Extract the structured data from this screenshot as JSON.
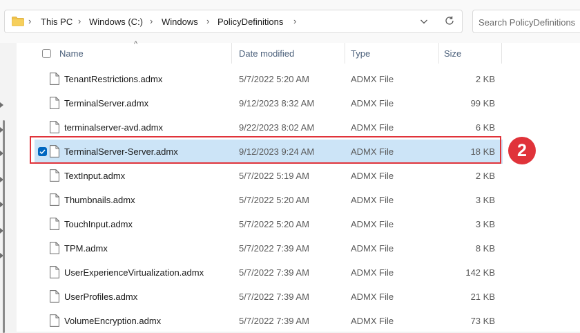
{
  "address_bar": {
    "breadcrumbs": [
      "This PC",
      "Windows (C:)",
      "Windows",
      "PolicyDefinitions"
    ]
  },
  "search": {
    "placeholder": "Search PolicyDefinitions"
  },
  "columns": {
    "name": "Name",
    "date": "Date modified",
    "type": "Type",
    "size": "Size"
  },
  "files": [
    {
      "name": "TenantRestrictions.admx",
      "date": "5/7/2022 5:20 AM",
      "type": "ADMX File",
      "size": "2 KB",
      "selected": false
    },
    {
      "name": "TerminalServer.admx",
      "date": "9/12/2023 8:32 AM",
      "type": "ADMX File",
      "size": "99 KB",
      "selected": false
    },
    {
      "name": "terminalserver-avd.admx",
      "date": "9/22/2023 8:02 AM",
      "type": "ADMX File",
      "size": "6 KB",
      "selected": false
    },
    {
      "name": "TerminalServer-Server.admx",
      "date": "9/12/2023 9:24 AM",
      "type": "ADMX File",
      "size": "18 KB",
      "selected": true
    },
    {
      "name": "TextInput.admx",
      "date": "5/7/2022 5:19 AM",
      "type": "ADMX File",
      "size": "2 KB",
      "selected": false
    },
    {
      "name": "Thumbnails.admx",
      "date": "5/7/2022 5:20 AM",
      "type": "ADMX File",
      "size": "3 KB",
      "selected": false
    },
    {
      "name": "TouchInput.admx",
      "date": "5/7/2022 5:20 AM",
      "type": "ADMX File",
      "size": "3 KB",
      "selected": false
    },
    {
      "name": "TPM.admx",
      "date": "5/7/2022 7:39 AM",
      "type": "ADMX File",
      "size": "8 KB",
      "selected": false
    },
    {
      "name": "UserExperienceVirtualization.admx",
      "date": "5/7/2022 7:39 AM",
      "type": "ADMX File",
      "size": "142 KB",
      "selected": false
    },
    {
      "name": "UserProfiles.admx",
      "date": "5/7/2022 7:39 AM",
      "type": "ADMX File",
      "size": "21 KB",
      "selected": false
    },
    {
      "name": "VolumeEncryption.admx",
      "date": "5/7/2022 7:39 AM",
      "type": "ADMX File",
      "size": "73 KB",
      "selected": false
    }
  ],
  "annotation": {
    "step_number": "2",
    "color": "#e0333a"
  },
  "colors": {
    "selection": "#cce4f7",
    "accent": "#0067c0",
    "header_text": "#4a5f7a"
  },
  "icons": [
    "folder-icon",
    "chevron-right-icon",
    "chevron-down-icon",
    "refresh-icon",
    "file-icon",
    "checkbox-icon",
    "sort-ascending-icon"
  ]
}
